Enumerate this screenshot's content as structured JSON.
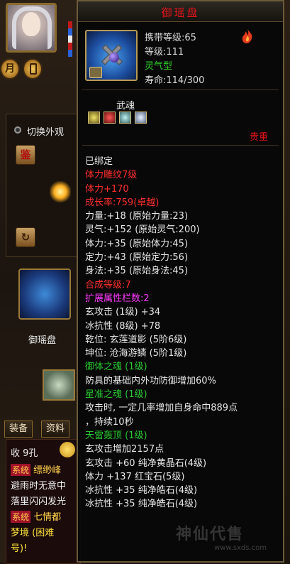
{
  "tooltip": {
    "title": "御瑶盘",
    "carry_level": "携带等级:65",
    "level": "等级:111",
    "type": "灵气型",
    "life": "寿命:114/300",
    "soul_label": "武魂",
    "rarity": "贵重",
    "attributes": [
      {
        "text": "已绑定",
        "color": "white"
      },
      {
        "text": "体力雕纹7级",
        "color": "red"
      },
      {
        "text": "体力+170",
        "color": "red"
      },
      {
        "text": "成长率:759(卓越)",
        "color": "red"
      },
      {
        "text": "力量:+18  (原始力量:23)",
        "color": "white"
      },
      {
        "text": "灵气:+152  (原始灵气:200)",
        "color": "white"
      },
      {
        "text": "体力:+35  (原始体力:45)",
        "color": "white"
      },
      {
        "text": "定力:+43  (原始定力:56)",
        "color": "white"
      },
      {
        "text": "身法:+35  (原始身法:45)",
        "color": "white"
      },
      {
        "text": "合成等级:7",
        "color": "red"
      },
      {
        "text": "扩展属性栏数:2",
        "color": "pink"
      },
      {
        "text": "玄攻击 (1级) +34",
        "color": "white"
      },
      {
        "text": "冰抗性 (8级) +78",
        "color": "white"
      },
      {
        "text": "乾位: 玄莲道影 (5阶6级)",
        "color": "white"
      },
      {
        "text": "坤位: 沧海游鳞 (5阶1级)",
        "color": "white"
      },
      {
        "text": "御体之魂 (1级)",
        "color": "green"
      },
      {
        "text": "防具的基础内外功防御增加60%",
        "color": "white"
      },
      {
        "text": "星准之魂 (1级)",
        "color": "green"
      },
      {
        "text": "攻击时, 一定几率增加自身命中889点",
        "color": "white"
      },
      {
        "text": "，持续10秒",
        "color": "white"
      },
      {
        "text": "天雷轰顶 (1级)",
        "color": "green"
      },
      {
        "text": "玄攻击增加2157点",
        "color": "white"
      },
      {
        "text": "玄攻击 +60 纯净黄晶石(4级)",
        "color": "white"
      },
      {
        "text": "体力 +137 红宝石(5级)",
        "color": "white"
      },
      {
        "text": "冰抗性 +35 纯净皓石(4级)",
        "color": "white"
      },
      {
        "text": "冰抗性 +35 纯净皓石(4级)",
        "color": "white"
      }
    ]
  },
  "left": {
    "switch_look": "切换外观",
    "appraise_icon_text": "鉴",
    "month_btn": "月",
    "pet_name": "御瑶盘",
    "tabs": [
      "装备",
      "资料"
    ],
    "chat": {
      "line1": "收 9孔",
      "line2_tag": "系统",
      "line2_text": "缥缈峰",
      "line3": "避雨时无意中",
      "line4": "落里闪闪发光",
      "line5_tag": "系统",
      "line5_text": "七情都",
      "line6": "梦境 (困难",
      "line7": "号)!"
    }
  },
  "watermark": {
    "text": "神仙代售",
    "url": "www.sxds.com"
  },
  "colors": {
    "title_red": "#e8121a",
    "attr_red": "#ff2e2e",
    "attr_pink": "#ff3aff",
    "attr_green": "#27c930",
    "border_gold": "#6b5a3a"
  }
}
